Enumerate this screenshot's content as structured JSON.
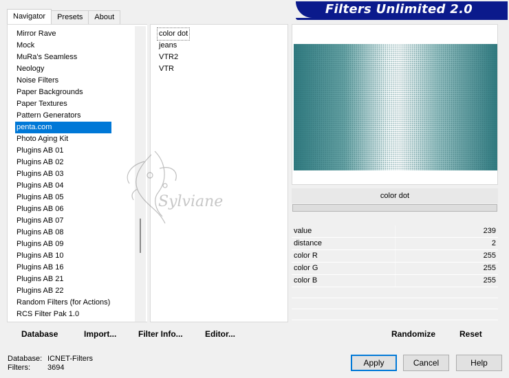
{
  "tabs": [
    {
      "label": "Navigator",
      "active": true
    },
    {
      "label": "Presets",
      "active": false
    },
    {
      "label": "About",
      "active": false
    }
  ],
  "banner": {
    "title": "Filters Unlimited 2.0",
    "color": "#0b1a8c"
  },
  "categories": [
    {
      "label": "Mirror Rave"
    },
    {
      "label": "Mock"
    },
    {
      "label": "MuRa's Seamless"
    },
    {
      "label": "Neology"
    },
    {
      "label": "Noise Filters"
    },
    {
      "label": "Paper Backgrounds"
    },
    {
      "label": "Paper Textures"
    },
    {
      "label": "Pattern Generators"
    },
    {
      "label": "penta.com",
      "selected": true
    },
    {
      "label": "Photo Aging Kit"
    },
    {
      "label": "Plugins AB 01"
    },
    {
      "label": "Plugins AB 02"
    },
    {
      "label": "Plugins AB 03"
    },
    {
      "label": "Plugins AB 04"
    },
    {
      "label": "Plugins AB 05"
    },
    {
      "label": "Plugins AB 06"
    },
    {
      "label": "Plugins AB 07"
    },
    {
      "label": "Plugins AB 08"
    },
    {
      "label": "Plugins AB 09"
    },
    {
      "label": "Plugins AB 10"
    },
    {
      "label": "Plugins AB 16"
    },
    {
      "label": "Plugins AB 21"
    },
    {
      "label": "Plugins AB 22"
    },
    {
      "label": "Random Filters (for Actions)"
    },
    {
      "label": "RCS Filter Pak 1.0"
    }
  ],
  "filters": [
    {
      "label": "color dot",
      "selected": true
    },
    {
      "label": "jeans"
    },
    {
      "label": "VTR2"
    },
    {
      "label": "VTR"
    }
  ],
  "preview": {
    "filter_name": "color dot",
    "accent": "#2f7a80"
  },
  "parameters": [
    {
      "name": "value",
      "value": "239"
    },
    {
      "name": "distance",
      "value": "2"
    },
    {
      "name": "color R",
      "value": "255"
    },
    {
      "name": "color G",
      "value": "255"
    },
    {
      "name": "color B",
      "value": "255"
    }
  ],
  "toolbar": {
    "database_label": "Database",
    "import_label": "Import...",
    "filter_info_label": "Filter Info...",
    "editor_label": "Editor...",
    "randomize_label": "Randomize",
    "reset_label": "Reset"
  },
  "status": {
    "database_label": "Database:",
    "database_value": "ICNET-Filters",
    "filters_label": "Filters:",
    "filters_value": "3694"
  },
  "buttons": {
    "apply_label": "Apply",
    "cancel_label": "Cancel",
    "help_label": "Help"
  },
  "watermark": {
    "text": "Sylviane"
  }
}
